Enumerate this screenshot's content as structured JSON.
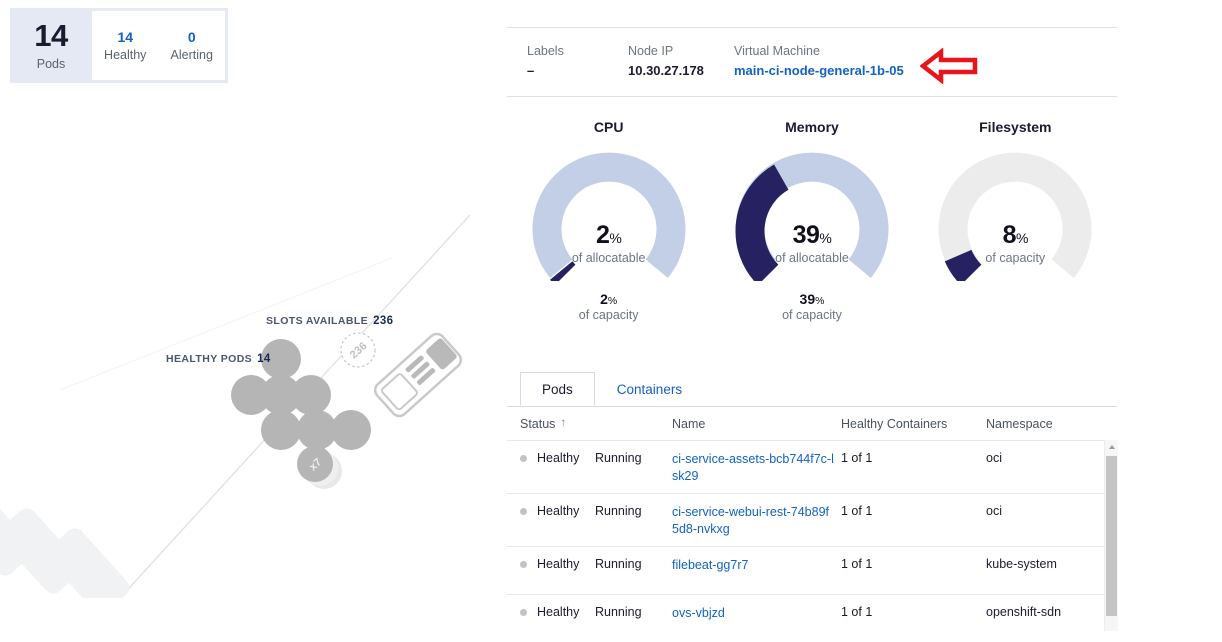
{
  "pods_card": {
    "count": "14",
    "label": "Pods",
    "healthy_value": "14",
    "healthy_label": "Healthy",
    "alerting_value": "0",
    "alerting_label": "Alerting"
  },
  "topology": {
    "slots_label": "SLOTS AVAILABLE",
    "slots_value": "236",
    "healthy_pods_label": "HEALTHY PODS",
    "healthy_pods_value": "14",
    "slot_bubble_value": "236",
    "stack_badge": "x7"
  },
  "node_info": {
    "labels_key": "Labels",
    "labels_value": "–",
    "node_ip_key": "Node IP",
    "node_ip_value": "10.30.27.178",
    "vm_key": "Virtual Machine",
    "vm_value": "main-ci-node-general-1b-05"
  },
  "annotation": {
    "shape": "left-arrow",
    "color": "#e8161a"
  },
  "gauges": [
    {
      "title": "CPU",
      "value": "2",
      "unit": "%",
      "primary_caption": "of allocatable",
      "secondary_value": "2",
      "secondary_unit": "%",
      "secondary_caption": "of capacity",
      "percent": 2,
      "track_color": "#c3cfe6",
      "fill_color": "#262262"
    },
    {
      "title": "Memory",
      "value": "39",
      "unit": "%",
      "primary_caption": "of allocatable",
      "secondary_value": "39",
      "secondary_unit": "%",
      "secondary_caption": "of capacity",
      "percent": 39,
      "track_color": "#c3cfe6",
      "fill_color": "#262262"
    },
    {
      "title": "Filesystem",
      "value": "8",
      "unit": "%",
      "primary_caption": "of capacity",
      "secondary_value": "",
      "secondary_unit": "",
      "secondary_caption": "",
      "percent": 8,
      "track_color": "#ececec",
      "fill_color": "#262262"
    }
  ],
  "tabs": [
    {
      "label": "Pods",
      "active": true
    },
    {
      "label": "Containers",
      "active": false
    }
  ],
  "table": {
    "columns": [
      "Status",
      "Name",
      "Healthy Containers",
      "Namespace"
    ],
    "sort_column": "Status",
    "sort_direction": "↑",
    "rows": [
      {
        "health": "Healthy",
        "state": "Running",
        "name": "ci-service-assets-bcb744f7c-lsk29",
        "healthy_containers": "1 of 1",
        "namespace": "oci"
      },
      {
        "health": "Healthy",
        "state": "Running",
        "name": "ci-service-webui-rest-74b89f5d8-nvkxg",
        "healthy_containers": "1 of 1",
        "namespace": "oci"
      },
      {
        "health": "Healthy",
        "state": "Running",
        "name": "filebeat-gg7r7",
        "healthy_containers": "1 of 1",
        "namespace": "kube-system"
      },
      {
        "health": "Healthy",
        "state": "Running",
        "name": "ovs-vbjzd",
        "healthy_containers": "1 of 1",
        "namespace": "openshift-sdn"
      }
    ]
  }
}
